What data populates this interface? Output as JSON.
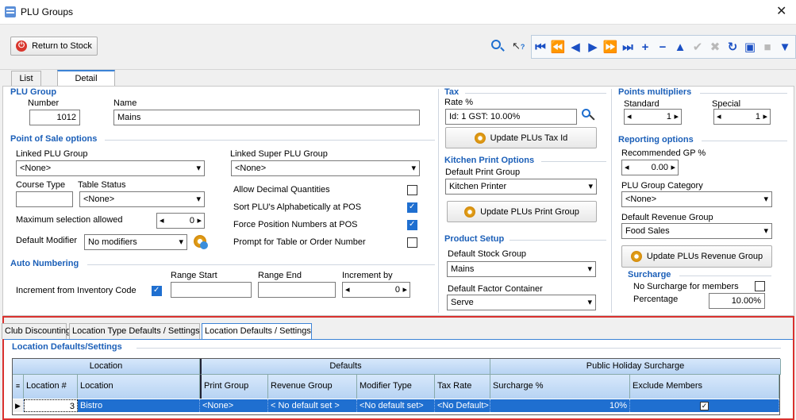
{
  "window": {
    "title": "PLU Groups"
  },
  "toolbar": {
    "return_label": "Return to Stock"
  },
  "tabs": [
    "List",
    "Detail"
  ],
  "plu_group": {
    "header": "PLU Group",
    "number_label": "Number",
    "number": "1012",
    "name_label": "Name",
    "name": "Mains"
  },
  "pos": {
    "header": "Point of Sale options",
    "linked_plu_label": "Linked PLU Group",
    "linked_plu": "<None>",
    "linked_super_label": "Linked Super PLU Group",
    "linked_super": "<None>",
    "course_type_label": "Course Type",
    "course_type": "",
    "table_status_label": "Table Status",
    "table_status": "<None>",
    "max_sel_label": "Maximum selection allowed",
    "max_sel": "0",
    "default_modifier_label": "Default Modifier",
    "default_modifier": "No modifiers",
    "allow_decimal": "Allow Decimal Quantities",
    "sort_alpha": "Sort PLU's Alphabetically at POS",
    "force_position": "Force Position Numbers at POS",
    "prompt_table": "Prompt for Table or Order Number"
  },
  "auto_numbering": {
    "header": "Auto Numbering",
    "increment_from_inventory": "Increment from Inventory Code",
    "range_start_label": "Range Start",
    "range_start": "",
    "range_end_label": "Range End",
    "range_end": "",
    "increment_by_label": "Increment by",
    "increment_by": "0"
  },
  "tax": {
    "header": "Tax",
    "rate_label": "Rate %",
    "rate": "Id: 1 GST: 10.00%",
    "update_btn": "Update PLUs Tax Id"
  },
  "kitchen": {
    "header": "Kitchen Print Options",
    "default_label": "Default Print Group",
    "default": "Kitchen Printer",
    "update_btn": "Update PLUs Print Group"
  },
  "product": {
    "header": "Product Setup",
    "stock_group_label": "Default Stock Group",
    "stock_group": "Mains",
    "factor_label": "Default Factor Container",
    "factor": "Serve"
  },
  "points": {
    "header": "Points multipliers",
    "standard_label": "Standard",
    "standard": "1",
    "special_label": "Special",
    "special": "1"
  },
  "reporting": {
    "header": "Reporting options",
    "gp_label": "Recommended GP %",
    "gp": "0.00",
    "category_label": "PLU Group Category",
    "category": "<None>",
    "revenue_label": "Default Revenue Group",
    "revenue": "Food Sales",
    "update_btn": "Update PLUs Revenue Group"
  },
  "surcharge": {
    "header": "Surcharge",
    "no_surcharge": "No Surcharge for members",
    "percentage_label": "Percentage",
    "percentage": "10.00%"
  },
  "bottom_tabs": [
    "Club Discounting",
    "Location Type Defaults / Settings",
    "Location Defaults / Settings"
  ],
  "location": {
    "header": "Location Defaults/Settings",
    "groups": [
      "Location",
      "Defaults",
      "Public Holiday Surcharge"
    ],
    "columns": [
      "Location #",
      "Location",
      "Print Group",
      "Revenue Group",
      "Modifier Type",
      "Tax Rate",
      "Surcharge %",
      "Exclude Members"
    ],
    "row": {
      "loc_num": "3",
      "location": "Bistro",
      "print_group": "<None>",
      "revenue_group": "< No default set >",
      "modifier_type": "<No default set>",
      "tax_rate": "<No Default>",
      "surcharge": "10%"
    }
  },
  "colors": {
    "accent": "#1f6fd0",
    "header_text": "#1b5fb8",
    "highlight_border": "#d9312e"
  }
}
